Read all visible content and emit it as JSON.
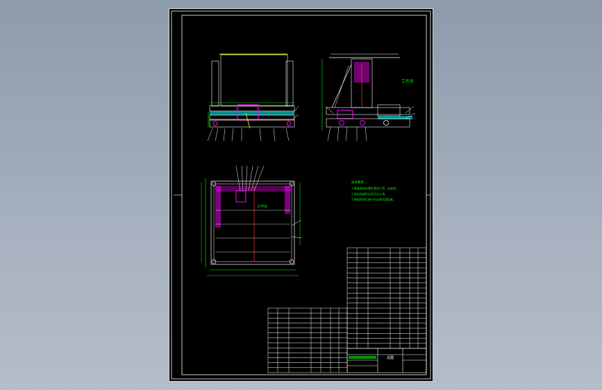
{
  "drawing": {
    "colors": {
      "background": "#000000",
      "frame": "#ffffff",
      "dimension": "#00ff00",
      "highlight": "#ff00ff",
      "accent": "#ffff00",
      "cyan": "#00ffff",
      "red": "#ff3030"
    },
    "side_view_label": "工作台",
    "plan_label": "工作台",
    "tech_notes": {
      "heading": "技术要求",
      "lines": [
        "1.装配前所有零件清洗干净，去毛刺。",
        "2.各运动部件应灵活无卡滞。",
        "3.装配完成后进行空运转试验检查。"
      ]
    },
    "title_block": {
      "title": "总图"
    }
  }
}
